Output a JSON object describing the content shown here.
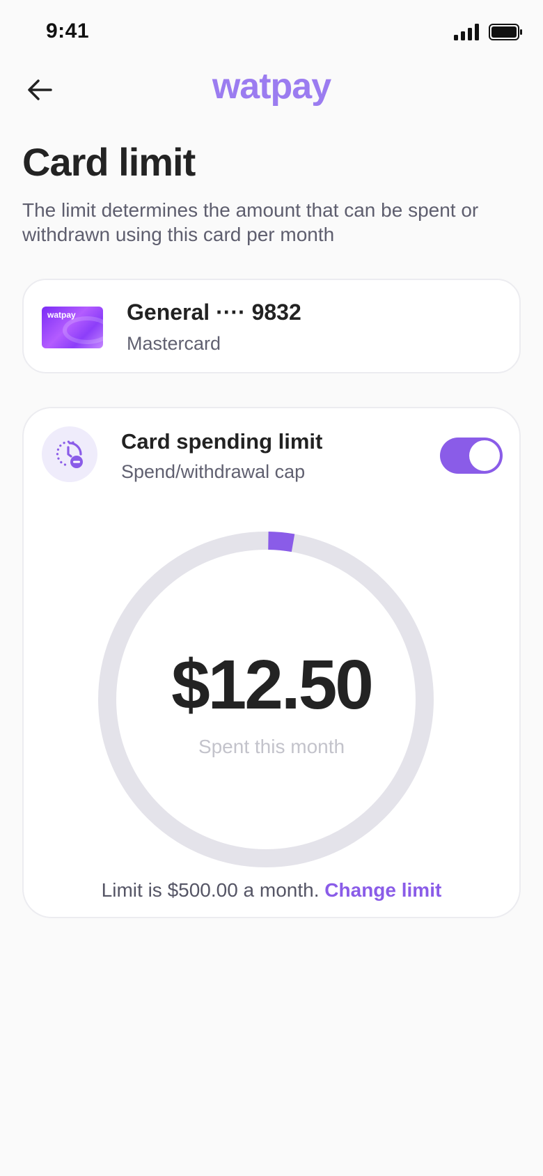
{
  "status_bar": {
    "time": "9:41"
  },
  "header": {
    "brand": "watpay"
  },
  "page": {
    "title": "Card limit",
    "description": "The limit determines the amount that can be spent or withdrawn using this card per month"
  },
  "card": {
    "thumb_logo": "watpay",
    "name": "General ···· 9832",
    "type": "Mastercard"
  },
  "spending_limit": {
    "title": "Card spending limit",
    "subtitle": "Spend/withdrawal cap",
    "enabled": true,
    "amount_spent": "$12.50",
    "caption": "Spent this month",
    "spent_fraction": 0.025,
    "limit_text": "Limit is $500.00 a month.",
    "change_link": "Change limit"
  },
  "colors": {
    "accent": "#8A5CE8",
    "brand": "#9B7CF0",
    "ring_track": "#E4E3EA",
    "background": "#FAFAFA"
  },
  "icons": [
    "back-arrow-icon",
    "signal-icon",
    "battery-icon",
    "timer-minus-icon"
  ]
}
